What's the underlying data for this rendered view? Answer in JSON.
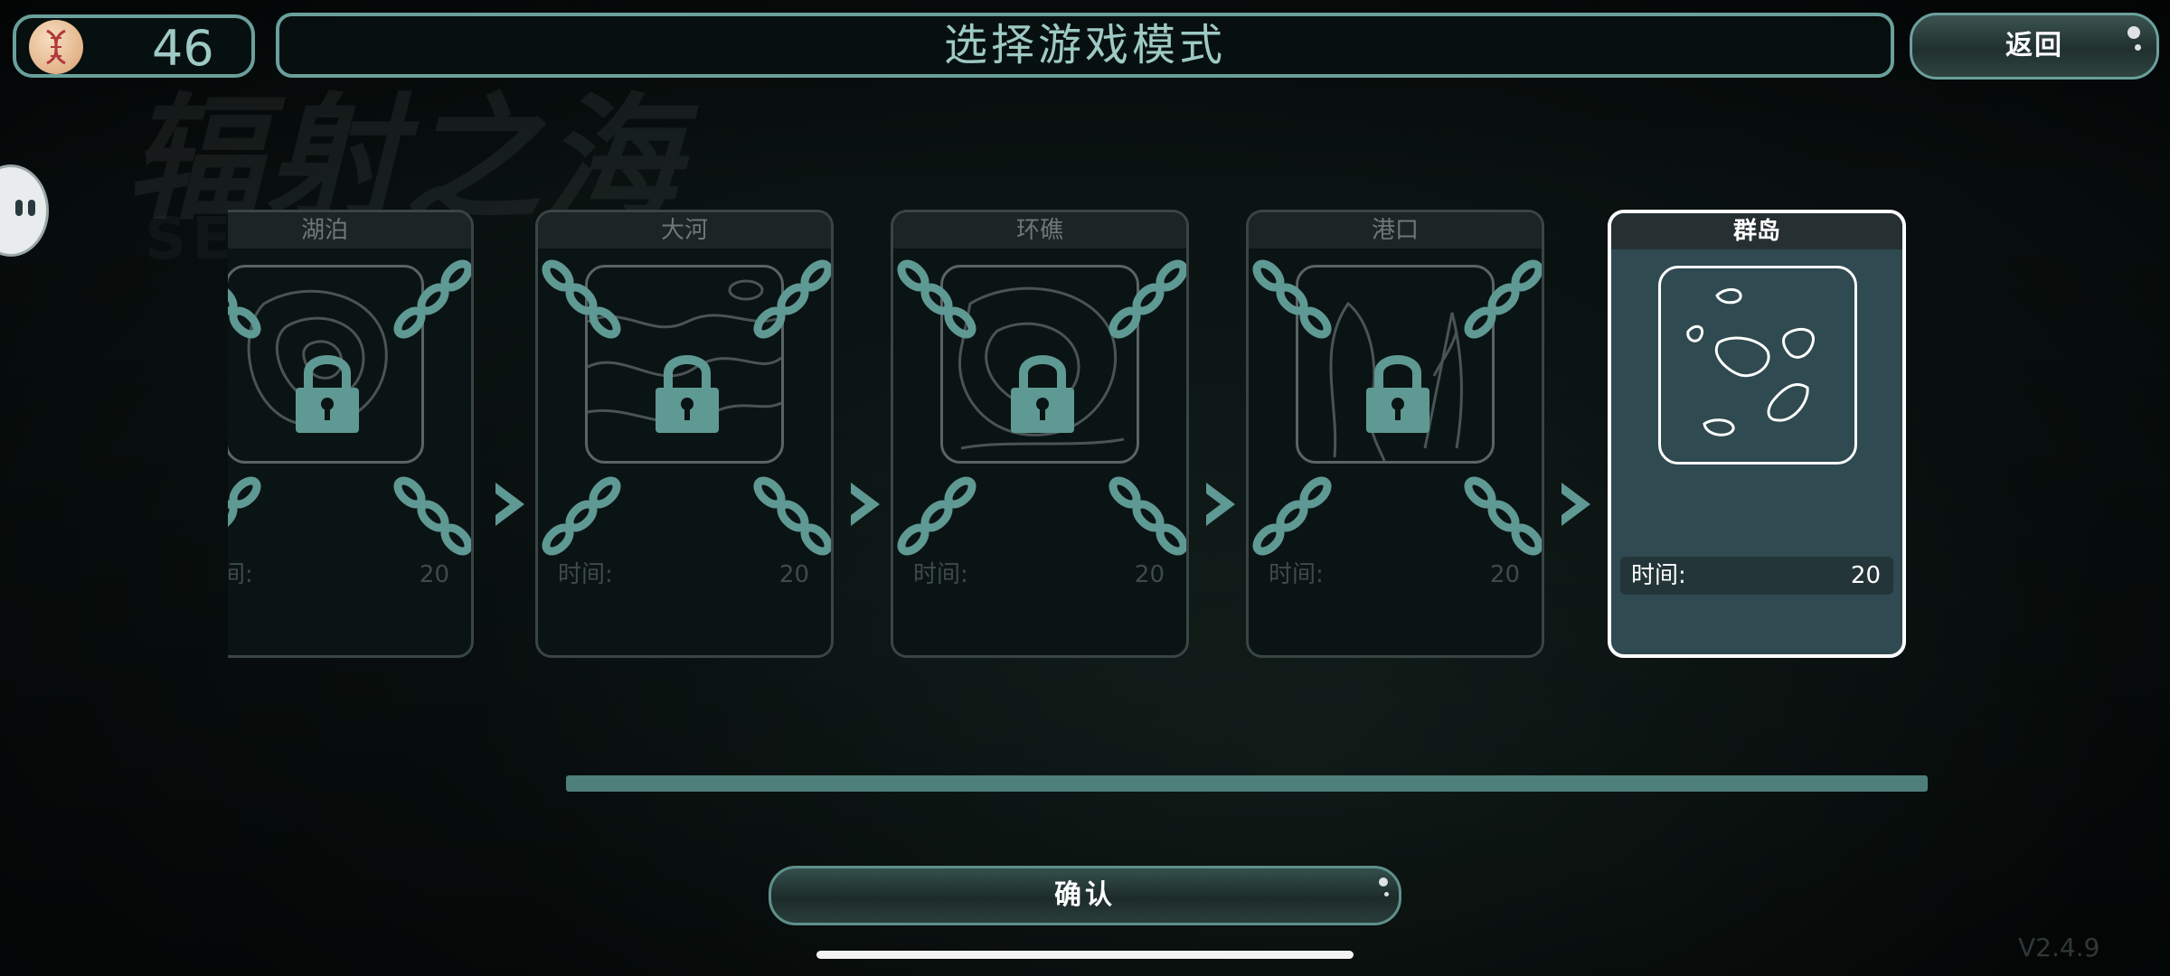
{
  "coin": {
    "value": "46",
    "icon": "dna-coin-icon"
  },
  "header": {
    "title": "选择游戏模式"
  },
  "back_button": {
    "label": "返回"
  },
  "background": {
    "title": "辐射之海",
    "subtitle": "SEA ODE"
  },
  "cards": [
    {
      "name": "湖泊",
      "time_label": "时间:",
      "time_value": "20",
      "locked": true,
      "selected": false,
      "map_icon": "lake-topo-map-icon"
    },
    {
      "name": "大河",
      "time_label": "时间:",
      "time_value": "20",
      "locked": true,
      "selected": false,
      "map_icon": "river-topo-map-icon"
    },
    {
      "name": "环礁",
      "time_label": "时间:",
      "time_value": "20",
      "locked": true,
      "selected": false,
      "map_icon": "atoll-topo-map-icon"
    },
    {
      "name": "港口",
      "time_label": "时间:",
      "time_value": "20",
      "locked": true,
      "selected": false,
      "map_icon": "harbor-map-icon"
    },
    {
      "name": "群岛",
      "time_label": "时间:",
      "time_value": "20",
      "locked": false,
      "selected": true,
      "map_icon": "archipelago-map-icon"
    }
  ],
  "confirm_button": {
    "label": "确认"
  },
  "version": "V2.4.9",
  "colors": {
    "accent": "#6aa09c",
    "lock": "#6aa09c",
    "selected_card": "#2f4a50"
  }
}
